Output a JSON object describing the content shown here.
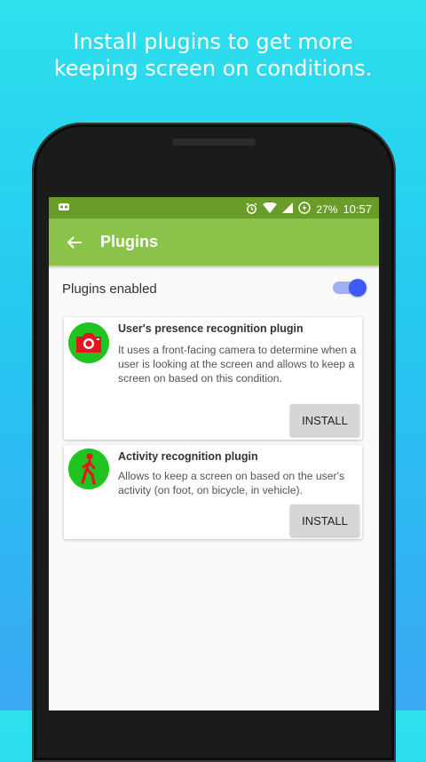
{
  "promo": {
    "line1": "Install plugins to get more",
    "line2": "keeping screen on conditions."
  },
  "statusbar": {
    "battery_percent": "27%",
    "time": "10:57"
  },
  "appbar": {
    "title": "Plugins"
  },
  "settings": {
    "plugins_enabled_label": "Plugins enabled",
    "plugins_enabled_value": true
  },
  "plugins": [
    {
      "title": "User's presence recognition plugin",
      "description": "It uses a front-facing camera to determine when a user is looking at the screen and allows to keep a screen on based on this condition.",
      "button": "INSTALL",
      "icon": "camera-icon"
    },
    {
      "title": "Activity recognition plugin",
      "description": "Allows to keep a screen on based on the user's activity (on foot, on bicycle, in vehicle).",
      "button": "INSTALL",
      "icon": "walking-person-icon"
    }
  ],
  "colors": {
    "statusbar": "#6a9c2a",
    "appbar": "#8bc34a",
    "switch_thumb": "#3d5afe",
    "plugin_icon_bg": "#21c321",
    "plugin_icon_fg": "#e5141e"
  }
}
